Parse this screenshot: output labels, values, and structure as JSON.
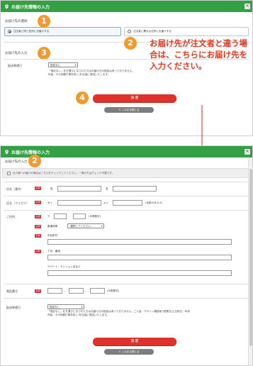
{
  "colors": {
    "header": "#33a043",
    "accent_orange": "#f29a2e",
    "red": "#e0322a",
    "annotation_red": "#e8371e"
  },
  "icons": {
    "pin": "location-pin-icon",
    "close": "close-icon",
    "check": "check-icon"
  },
  "panel1": {
    "title": "お届け先情報の入力",
    "select_label": "お届け先の選択",
    "radio_same": "注文者と同じ住所にお届けする",
    "radio_diff": "注文者と異なる住所にお届けする",
    "input_label": "お届け先の入力",
    "delivery_date_label": "配送希望日",
    "delivery_date_value": "指定なし",
    "note_line1": "「指定なし」をお選びになられた方はお届け日の指定は承っておりません。",
    "note_line2": "年始・その他繁忙期を除く)を目途に発送いたします。",
    "submit": "決 定",
    "close": "このまま閉じる",
    "badges": [
      "1",
      "2",
      "3",
      "4"
    ],
    "annotation": "お届け先が注文者と違う場合は、こちらにお届け先を入力ください。"
  },
  "panel2": {
    "title": "お届け先情報の入力",
    "input_label": "お届け先の入力",
    "badge": "2",
    "checkbox_text": "法人様へお届けの場合はこちらをチェックしてください。一般の方はチェック不要です。",
    "required": "必須",
    "name_label": "氏名（漢字）",
    "sei": "姓",
    "mei": "名",
    "kana_label": "氏名（フリガナ）",
    "sei_kana": "セイ",
    "mei_kana": "メイ",
    "kana_hint": "(全角カタカナ)",
    "address_label": "ご住所",
    "zip_mark": "〒",
    "zip_hint": "(半角数字)",
    "pref_label": "都道府県",
    "pref_value": "-選択してください-",
    "city_label": "市区町村",
    "street_label": "丁目・番地",
    "building_label": "アパート・マンション名など",
    "tel_label": "電話番号",
    "tel_hint": "(半角数字)",
    "delivery_date_label": "配送希望日",
    "delivery_date_value": "指定なし",
    "note_line1": "「指定なし」をお選びになられた方はお届け日の指定は承っておりません。ご入金・デザイン確認後7営業日(土日祝日・年末",
    "note_line2": "年始・その他繁忙期を除く)を目途に発送いたします。",
    "submit": "決 定",
    "close": "このまま閉じる",
    "dash": "-"
  }
}
